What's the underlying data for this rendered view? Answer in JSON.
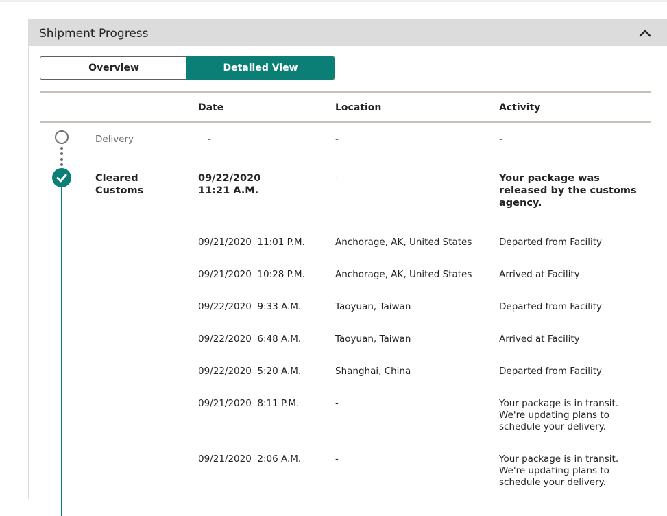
{
  "panel": {
    "title": "Shipment Progress"
  },
  "toggle": {
    "overview_label": "Overview",
    "detailed_label": "Detailed View"
  },
  "table": {
    "headers": {
      "date": "Date",
      "location": "Location",
      "activity": "Activity"
    },
    "milestones": [
      {
        "status": "Delivery",
        "date": "-",
        "location": "-",
        "activity": "-"
      },
      {
        "status": "Cleared\nCustoms",
        "date": "09/22/2020\n11:21 A.M.",
        "location": "-",
        "activity": "Your package was\nreleased by the customs\nagency."
      }
    ],
    "events": [
      {
        "date": "09/21/2020  11:01 P.M.",
        "location": "Anchorage, AK, United States",
        "activity": "Departed from Facility"
      },
      {
        "date": "09/21/2020  10:28 P.M.",
        "location": "Anchorage, AK, United States",
        "activity": "Arrived at Facility"
      },
      {
        "date": "09/22/2020  9:33 A.M.",
        "location": "Taoyuan, Taiwan",
        "activity": "Departed from Facility"
      },
      {
        "date": "09/22/2020  6:48 A.M.",
        "location": "Taoyuan, Taiwan",
        "activity": "Arrived at Facility"
      },
      {
        "date": "09/22/2020  5:20 A.M.",
        "location": "Shanghai, China",
        "activity": "Departed from Facility"
      },
      {
        "date": "09/21/2020  8:11 P.M.",
        "location": "-",
        "activity": "Your package is in transit.\nWe're updating plans to\nschedule your delivery."
      },
      {
        "date": "09/21/2020  2:06 A.M.",
        "location": "-",
        "activity": "Your package is in transit.\nWe're updating plans to\nschedule your delivery."
      }
    ]
  },
  "icons": {
    "collapse": "chevron-up-icon",
    "pending": "empty-circle-icon",
    "done": "checkmark-circle-icon"
  },
  "colors": {
    "accent": "#0b7f75",
    "header_bg": "#dcdcdc",
    "focus_ring": "#f0b070"
  }
}
